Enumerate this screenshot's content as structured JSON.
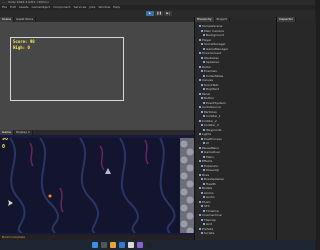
{
  "window": {
    "title": "... - Unity 2022.3.XXf1 <DX11>"
  },
  "menu": [
    "File",
    "Edit",
    "Assets",
    "GameObject",
    "Component",
    "Services",
    "Jobs",
    "Window",
    "Help"
  ],
  "toolbar": {
    "play": "▶",
    "pause": "❚❚",
    "step": "▶|"
  },
  "scene_view": {
    "tabs": [
      "Scene",
      "Asset Store"
    ],
    "score_text": "Score: 90",
    "high_text": "High: 0"
  },
  "game_view": {
    "tabs": [
      "Game",
      "Display 1"
    ],
    "score": "90",
    "high": "0"
  },
  "hierarchy": {
    "tabs": [
      "Hierarchy",
      "Project"
    ],
    "items": [
      "SampleScene",
      "Main Camera",
      "Background",
      "Player",
      "ScoreManager",
      "GameManager",
      "Environment",
      "Obstacles",
      "Spawner",
      "Rocks",
      "Enemies",
      "Collectibles",
      "Canvas",
      "ScoreText",
      "HighText",
      "Panel",
      "Button",
      "EventSystem",
      "AudioSource",
      "Particles",
      "Collider_1",
      "Collider_2",
      "Collider_3",
      "Waypoints",
      "Lights",
      "PostProcess",
      "UI",
      "PauseMenu",
      "GameOver",
      "Menu",
      "Effects",
      "Explosion",
      "PowerUp",
      "Boss",
      "BossSpawner",
      "Health",
      "Bullets",
      "Ammo",
      "Audio",
      "Music",
      "SFX",
      "Timeline",
      "Cinemachine",
      "Tilemap",
      "Grid",
      "Prefabs",
      "Scripts"
    ]
  },
  "inspector": {
    "tab": "Inspector"
  },
  "status": {
    "message": "Build Complete"
  }
}
